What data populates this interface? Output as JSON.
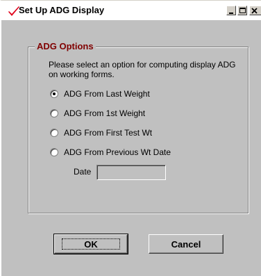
{
  "window": {
    "title": "Set Up ADG Display",
    "title_icon": "red-checkmark-icon",
    "controls": [
      "minimize-icon",
      "maximize-icon",
      "close-icon"
    ]
  },
  "group": {
    "label": "ADG Options",
    "description": "Please select an option for computing display ADG on working forms."
  },
  "options": [
    {
      "label": "ADG From Last Weight",
      "checked": true
    },
    {
      "label": "ADG From 1st Weight",
      "checked": false
    },
    {
      "label": "ADG From First Test Wt",
      "checked": false
    },
    {
      "label": "ADG From Previous Wt Date",
      "checked": false
    }
  ],
  "date": {
    "label": "Date",
    "value": ""
  },
  "buttons": {
    "ok_label": "OK",
    "cancel_label": "Cancel"
  },
  "colors": {
    "dialog_face": "#c0c0c0",
    "group_label": "#800000",
    "check_icon": "#e0001a"
  }
}
